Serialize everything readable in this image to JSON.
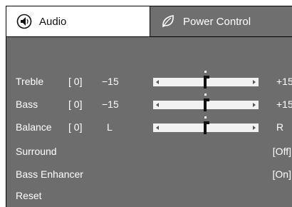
{
  "tabs": {
    "audio": {
      "label": "Audio",
      "icon": "speaker-icon",
      "active": true
    },
    "power": {
      "label": "Power Control",
      "icon": "leaf-icon",
      "active": false
    }
  },
  "rows": {
    "treble": {
      "label": "Treble",
      "value": "[ 0]",
      "min": "−15",
      "max": "+15",
      "level": 0.5
    },
    "bass": {
      "label": "Bass",
      "value": "[ 0]",
      "min": "−15",
      "max": "+15",
      "level": 0.5
    },
    "balance": {
      "label": "Balance",
      "value": "[ 0]",
      "min": "L",
      "max": "R",
      "level": 0.5
    },
    "surround": {
      "label": "Surround",
      "value": "[Off]"
    },
    "bass_enhancer": {
      "label": "Bass Enhancer",
      "value": "[On]"
    },
    "reset": {
      "label": "Reset"
    }
  },
  "colors": {
    "panel": "#6d6d6d",
    "inactive_tab": "#6f6f6f",
    "text": "#ffffff",
    "track": "#f2f2f2"
  }
}
